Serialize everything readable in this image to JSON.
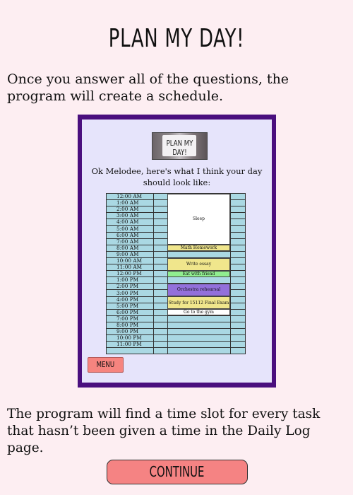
{
  "page": {
    "title": "PLAN MY DAY!",
    "intro": "Once you answer all of the questions, the program will create a schedule.",
    "outro": "The program will find a time slot for every task that hasn’t been given a time in the Daily Log page.",
    "continue_label": "CONTINUE"
  },
  "preview": {
    "logo_text": "PLAN MY DAY!",
    "message": "Ok Melodee, here's what I think your day should look like:",
    "menu_label": "MENU",
    "hours": [
      "12:00 AM",
      "1:00 AM",
      "2:00 AM",
      "3:00 AM",
      "4:00 AM",
      "5:00 AM",
      "6:00 AM",
      "7:00 AM",
      "8:00 AM",
      "9:00 AM",
      "10:00 AM",
      "11:00 AM",
      "12:00 PM",
      "1:00 PM",
      "2:00 PM",
      "3:00 PM",
      "4:00 PM",
      "5:00 PM",
      "6:00 PM",
      "7:00 PM",
      "8:00 PM",
      "9:00 PM",
      "10:00 PM",
      "11:00 PM"
    ],
    "tasks": [
      {
        "label": "Sleep",
        "start": 0,
        "end": 8,
        "color": "#ffffff"
      },
      {
        "label": "Math Homework",
        "start": 8,
        "end": 9,
        "color": "#f0e68c"
      },
      {
        "label": "Write essay",
        "start": 10,
        "end": 12,
        "color": "#f0e68c"
      },
      {
        "label": "Eat with friend",
        "start": 12,
        "end": 13,
        "color": "#90ee90"
      },
      {
        "label": "Orchestra rehearsal",
        "start": 14,
        "end": 16,
        "color": "#9370db"
      },
      {
        "label": "Study for 15112 Final Exam",
        "start": 16,
        "end": 18,
        "color": "#f0e68c"
      },
      {
        "label": "Go to the gym",
        "start": 18,
        "end": 19,
        "color": "#ffffff"
      }
    ]
  }
}
